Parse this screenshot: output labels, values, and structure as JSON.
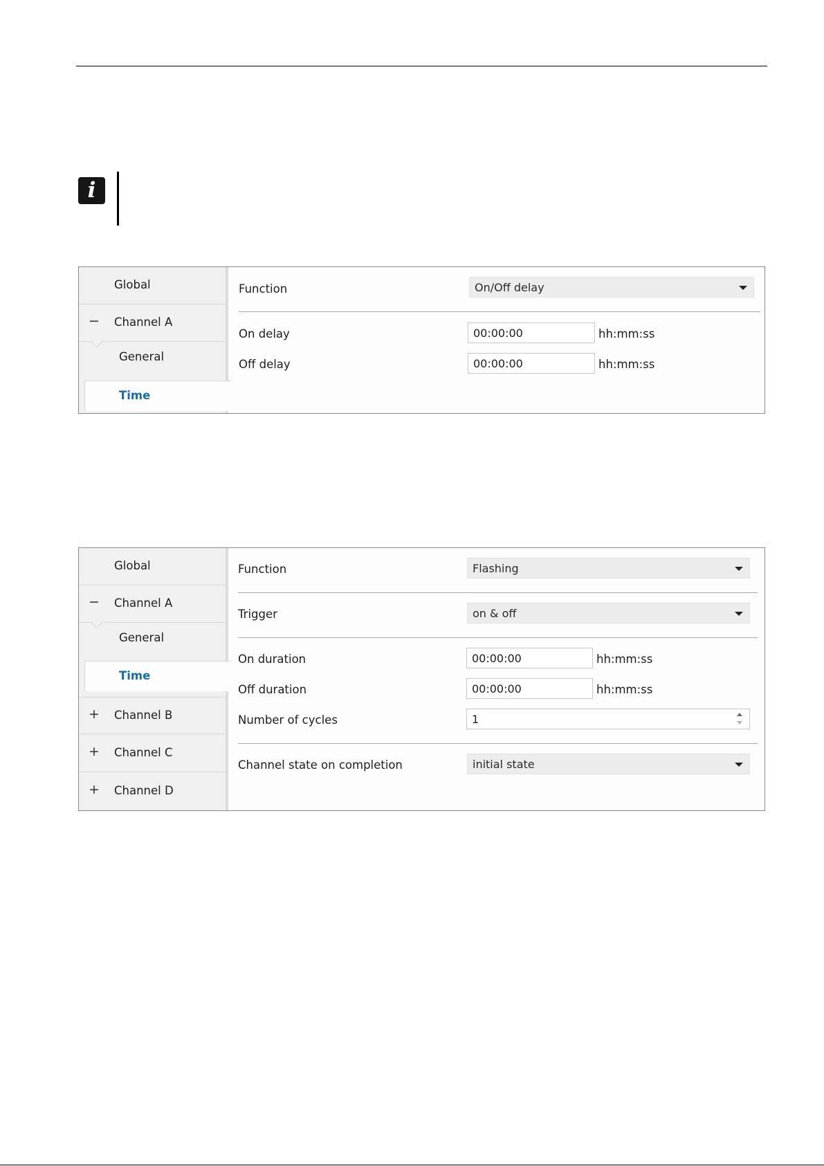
{
  "panel1": {
    "nav": {
      "global": "Global",
      "channel_a": {
        "toggle": "−",
        "label": "Channel A"
      },
      "sub_general": "General",
      "sub_time": "Time"
    },
    "function": {
      "label": "Function",
      "value": "On/Off delay"
    },
    "on_delay": {
      "label": "On delay",
      "value": "00:00:00",
      "unit": "hh:mm:ss"
    },
    "off_delay": {
      "label": "Off delay",
      "value": "00:00:00",
      "unit": "hh:mm:ss"
    }
  },
  "panel2": {
    "nav": {
      "global": "Global",
      "channel_a": {
        "toggle": "−",
        "label": "Channel A"
      },
      "sub_general": "General",
      "sub_time": "Time",
      "channel_b": {
        "toggle": "+",
        "label": "Channel B"
      },
      "channel_c": {
        "toggle": "+",
        "label": "Channel C"
      },
      "channel_d": {
        "toggle": "+",
        "label": "Channel D"
      }
    },
    "function": {
      "label": "Function",
      "value": "Flashing"
    },
    "trigger": {
      "label": "Trigger",
      "value": "on & off"
    },
    "on_duration": {
      "label": "On duration",
      "value": "00:00:00",
      "unit": "hh:mm:ss"
    },
    "off_duration": {
      "label": "Off duration",
      "value": "00:00:00",
      "unit": "hh:mm:ss"
    },
    "cycles": {
      "label": "Number of cycles",
      "value": "1"
    },
    "completion": {
      "label": "Channel state on completion",
      "value": "initial state"
    }
  },
  "info_icon": {
    "glyph": "i",
    "icon": "info-icon"
  },
  "colors": {
    "selected_nav": "#1a6cb0",
    "nav_bg": "#f0f0f0",
    "select_bg": "#ececec"
  }
}
